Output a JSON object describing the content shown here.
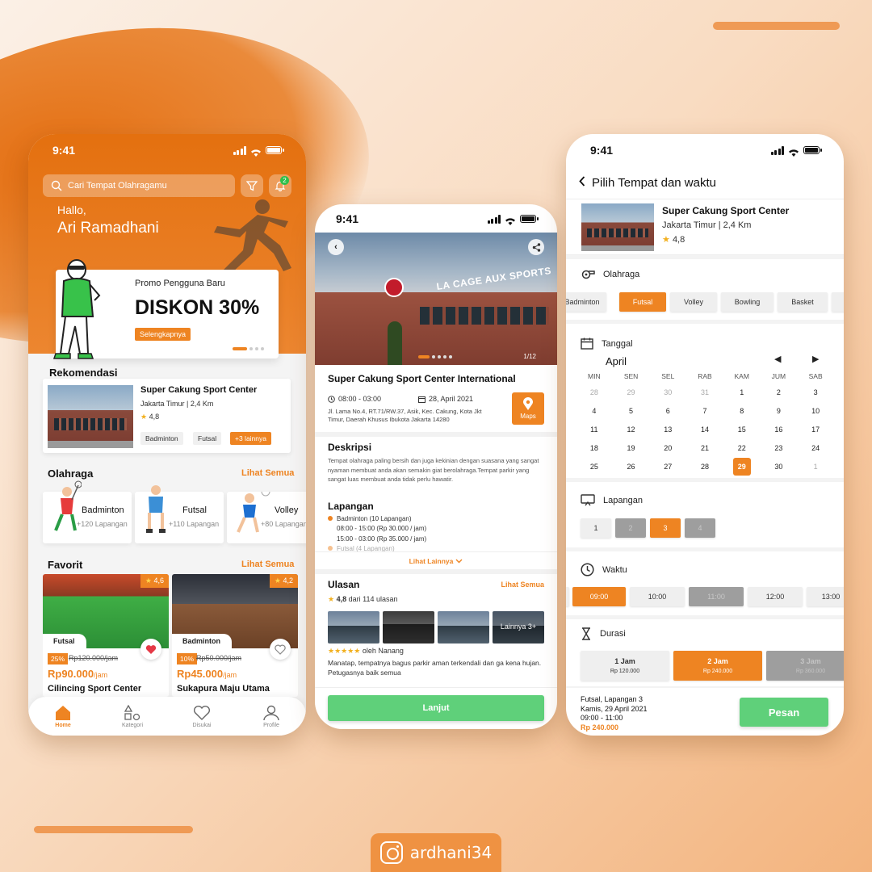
{
  "brand": {
    "accent": "#ee8422",
    "green": "#5fd07a",
    "handle": "ardhani34"
  },
  "status": {
    "time": "9:41"
  },
  "home": {
    "search_placeholder": "Cari Tempat Olahragamu",
    "notif_count": "2",
    "greeting": "Hallo,",
    "user_name": "Ari Ramadhani",
    "promo": {
      "subtitle": "Promo Pengguna Baru",
      "headline": "DISKON 30%",
      "cta": "Selengkapnya"
    },
    "recommend": {
      "title": "Rekomendasi",
      "name": "Super Cakung Sport Center",
      "location": "Jakarta Timur | 2,4 Km",
      "rating": "4,8",
      "tags": [
        "Badminton",
        "Futsal"
      ],
      "more": "+3 lainnya"
    },
    "sports": {
      "title": "Olahraga",
      "see_all": "Lihat Semua",
      "items": [
        {
          "name": "Badminton",
          "count": "+120 Lapangan"
        },
        {
          "name": "Futsal",
          "count": "+110 Lapangan"
        },
        {
          "name": "Volley",
          "count": "+80 Lapangan"
        }
      ]
    },
    "favorites": {
      "title": "Favorit",
      "see_all": "Lihat Semua",
      "items": [
        {
          "rating": "4,6",
          "tag": "Futsal",
          "discount": "25%",
          "old": "Rp120.000/jam",
          "price": "Rp90.000",
          "unit": "/jam",
          "name": "Cilincing Sport Center"
        },
        {
          "rating": "4,2",
          "tag": "Badminton",
          "discount": "10%",
          "old": "Rp50.000/jam",
          "price": "Rp45.000",
          "unit": "/jam",
          "name": "Sukapura Maju Utama"
        }
      ]
    },
    "tabs": [
      {
        "label": "Home",
        "icon": "home-icon"
      },
      {
        "label": "Kategori",
        "icon": "category-icon"
      },
      {
        "label": "Disukai",
        "icon": "heart-icon"
      },
      {
        "label": "Profile",
        "icon": "profile-icon"
      }
    ]
  },
  "detail": {
    "sign": "LA CAGE AUX SPORTS",
    "photo_count": "1/12",
    "title": "Super Cakung Sport Center International",
    "hours": "08:00 - 03:00",
    "date": "28, April 2021",
    "address": "Jl. Lama No.4, RT.71/RW.37, Asik, Kec. Cakung, Kota Jkt Timur, Daerah Khusus Ibukota Jakarta 14280",
    "maps": "Maps",
    "desc_title": "Deskripsi",
    "desc": "Tempat olahraga paling bersih dan juga kekinian dengan suasana yang sangat nyaman membuat anda akan semakin giat berolahraga.Tempat parkir yang sangat luas membuat anda tidak perlu hawatir.",
    "courts_title": "Lapangan",
    "courts": {
      "badminton": "Badminton (10 Lapangan)",
      "slot1": "08:00 - 15:00 (Rp 30.000 / jam)",
      "slot2": "15:00 - 03:00 (Rp 35.000 / jam)",
      "futsal": "Futsal (4 Lapangan)"
    },
    "more": "Lihat Lainnya",
    "review_title": "Ulasan",
    "review_see_all": "Lihat Semua",
    "rating": "4,8",
    "review_count": "dari 114 ulasan",
    "more_photos": "Lainnya 3+",
    "reviewer_prefix": "oleh",
    "reviewer": "Nanang",
    "review_text": "Manatap, tempatnya bagus parkir aman terkendali dan ga kena hujan. Petugasnya baik semua",
    "next": "Lanjut"
  },
  "booking": {
    "header": "Pilih Tempat dan waktu",
    "venue": {
      "name": "Super Cakung Sport Center",
      "location": "Jakarta Timur",
      "distance": "2,4 Km",
      "sep": "|",
      "rating": "4,8"
    },
    "sport_title": "Olahraga",
    "sports": [
      "Badminton",
      "Futsal",
      "Volley",
      "Bowling",
      "Basket"
    ],
    "date_title": "Tanggal",
    "month": "April",
    "weekdays": [
      "MIN",
      "SEN",
      "SEL",
      "RAB",
      "KAM",
      "JUM",
      "SAB"
    ],
    "days": [
      "28",
      "29",
      "30",
      "31",
      "1",
      "2",
      "3",
      "4",
      "5",
      "6",
      "7",
      "8",
      "9",
      "10",
      "11",
      "12",
      "13",
      "14",
      "15",
      "16",
      "17",
      "18",
      "19",
      "20",
      "21",
      "22",
      "23",
      "24",
      "25",
      "26",
      "27",
      "28",
      "29",
      "30",
      "1"
    ],
    "court_title": "Lapangan",
    "courts": [
      "1",
      "2",
      "3",
      "4"
    ],
    "time_title": "Waktu",
    "times": [
      "09:00",
      "10:00",
      "11:00",
      "12:00",
      "13:00"
    ],
    "duration_title": "Durasi",
    "durations": [
      {
        "label": "1 Jam",
        "price": "Rp 120.000"
      },
      {
        "label": "2 Jam",
        "price": "Rp 240.000"
      },
      {
        "label": "3 Jam",
        "price": "Rp 360.000"
      }
    ],
    "summary": {
      "line1": "Futsal, Lapangan 3",
      "line2": "Kamis, 29 April 2021",
      "line3": "09:00 - 11:00",
      "total": "Rp 240.000"
    },
    "order": "Pesan"
  }
}
